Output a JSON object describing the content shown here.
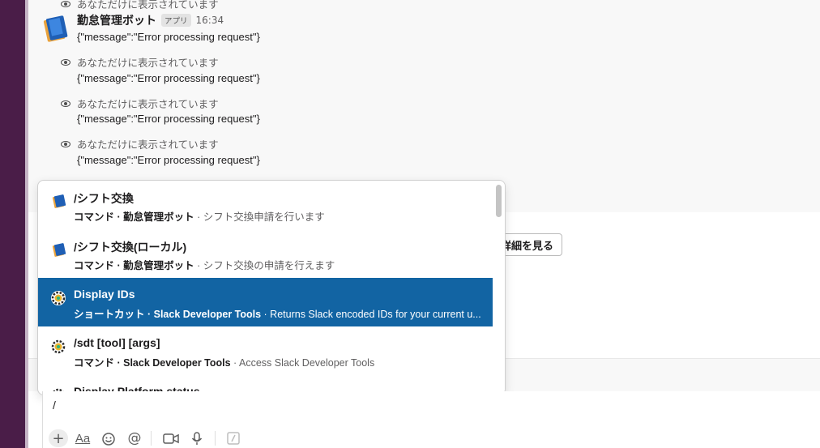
{
  "channel": {
    "ephemeral_label": "あなただけに表示されています",
    "bot": {
      "name": "勤怠管理ボット",
      "badge": "アプリ",
      "time": "16:34",
      "message": "{\"message\":\"Error processing request\"}"
    },
    "ephemeral_messages": [
      {
        "label": "あなただけに表示されています",
        "text": "{\"message\":\"Error processing request\"}"
      },
      {
        "label": "あなただけに表示されています",
        "text": "{\"message\":\"Error processing request\"}"
      },
      {
        "label": "あなただけに表示されています",
        "text": "{\"message\":\"Error processing request\"}"
      }
    ],
    "hidden_label": "あなただけに表示されています",
    "detail_button": "詳細を見る"
  },
  "autocomplete": {
    "items": [
      {
        "title": "/シフト交換",
        "kind": "コマンド · 勤怠管理ボット",
        "desc": " · シフト交換申請を行います",
        "icon": "book-icon",
        "selected": false
      },
      {
        "title": "/シフト交換(ローカル)",
        "kind": "コマンド · 勤怠管理ボット",
        "desc": " · シフト交換の申請を行えます",
        "icon": "book-icon",
        "selected": false
      },
      {
        "title": "Display IDs",
        "kind": "ショートカット · Slack Developer Tools",
        "desc": " · Returns Slack encoded IDs for your current u...",
        "icon": "gear-icon",
        "selected": true
      },
      {
        "title": "/sdt [tool] [args]",
        "kind": "コマンド · Slack Developer Tools",
        "desc": " · Access Slack Developer Tools",
        "icon": "gear-icon",
        "selected": false
      },
      {
        "title": "Display Platform status",
        "kind": "",
        "desc": "",
        "icon": "gear-icon",
        "selected": false
      }
    ]
  },
  "composer": {
    "value": "/",
    "toolbar": [
      "plus-icon",
      "format-icon",
      "emoji-icon",
      "mention-icon",
      "video-icon",
      "mic-icon",
      "slash-icon"
    ],
    "format_label": "Aa",
    "mention_label": "@"
  },
  "colors": {
    "selected": "#1264a3",
    "sidebar": "#4a1d48"
  }
}
